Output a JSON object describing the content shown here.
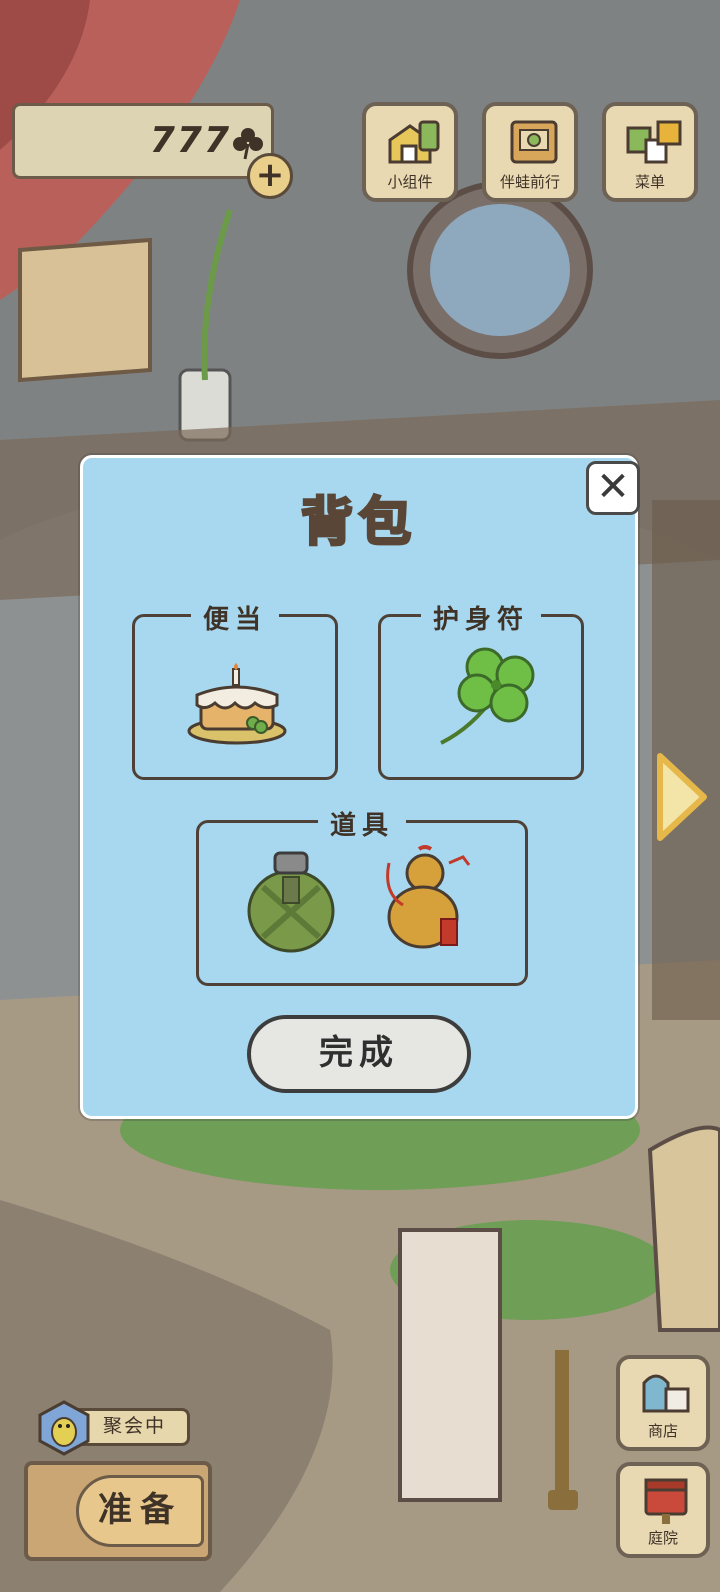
{
  "hud": {
    "clover_count": "777",
    "buttons": {
      "widgets_label": "小组件",
      "companion_label": "伴蛙前行",
      "menu_label": "菜单"
    }
  },
  "backpack": {
    "title": "背包",
    "lunch_label": "便当",
    "charm_label": "护身符",
    "tools_label": "道具",
    "done_label": "完成",
    "items": {
      "lunch": "cake-icon",
      "charm": "four-leaf-clover-icon",
      "tool_1": "canteen-icon",
      "tool_2": "gourd-icon"
    }
  },
  "bottom": {
    "status": "聚会中",
    "prepare_label": "准备",
    "shop_label": "商店",
    "yard_label": "庭院"
  },
  "colors": {
    "modal_bg": "#a8d8ef",
    "tile_bg": "#e9d9b2",
    "outline": "#4e4238"
  }
}
